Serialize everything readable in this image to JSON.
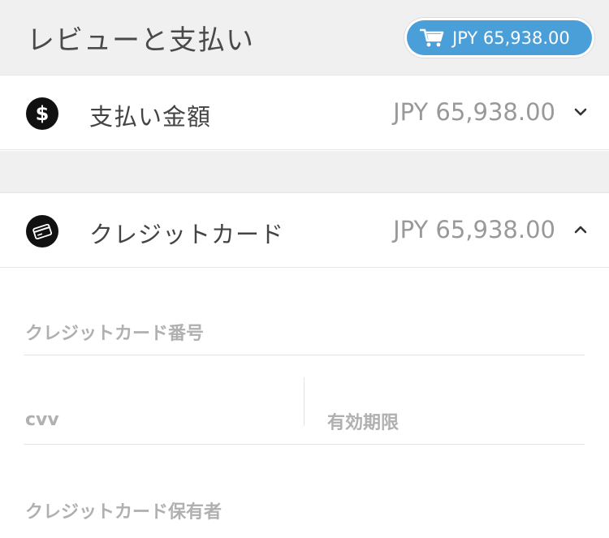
{
  "header": {
    "title": "レビューと支払い",
    "cart_total": "JPY 65,938.00"
  },
  "amount_row": {
    "icon": "dollar-icon",
    "label": "支払い金額",
    "value": "JPY 65,938.00",
    "chevron": "chevron-down-icon"
  },
  "card_row": {
    "icon": "credit-card-icon",
    "label": "クレジットカード",
    "value": "JPY 65,938.00",
    "chevron": "chevron-up-icon"
  },
  "form": {
    "card_number_placeholder": "クレジットカード番号",
    "cvv_placeholder": "cvv",
    "expiry_placeholder": "有効期限",
    "holder_placeholder": "クレジットカード保有者"
  },
  "colors": {
    "accent": "#4a9fd9",
    "header_bg": "#f0f0f0"
  }
}
